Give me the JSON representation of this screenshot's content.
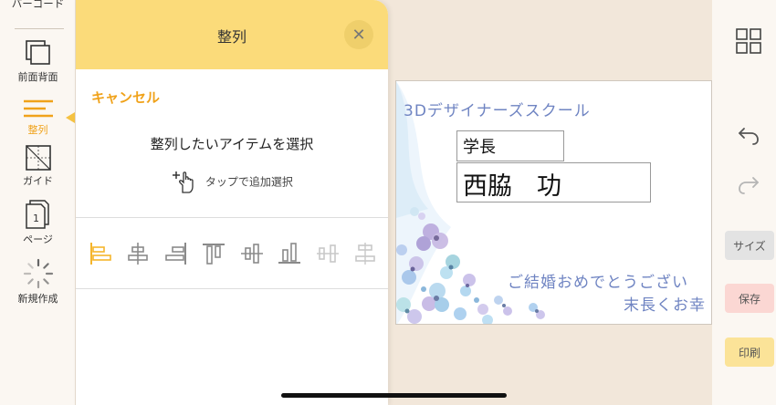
{
  "left_toolbar": {
    "barcode_label": "バーコード",
    "front_back_label": "前面背面",
    "align_label": "整列",
    "guide_label": "ガイド",
    "page_label": "ページ",
    "new_label": "新規作成",
    "active_item": "align",
    "accent_color": "#f0a21a"
  },
  "panel": {
    "title": "整列",
    "cancel_label": "キャンセル",
    "instruction": "整列したいアイテムを選択",
    "tap_hint": "タップで追加選択",
    "header_color": "#fbdb7a",
    "align_icons": [
      "align-left-icon",
      "align-center-horizontal-icon",
      "align-right-icon",
      "align-top-icon",
      "align-center-vertical-icon",
      "align-bottom-icon",
      "distribute-horizontal-icon",
      "distribute-vertical-icon"
    ]
  },
  "card": {
    "school_name": "3Dデザイナーズスクール",
    "title": "学長",
    "name": "西脇　功",
    "congrats_line1": "ご結婚おめでとうござい",
    "congrats_line2": "末長くお幸"
  },
  "right_toolbar": {
    "size_label": "サイズ",
    "save_label": "保存",
    "print_label": "印刷"
  }
}
